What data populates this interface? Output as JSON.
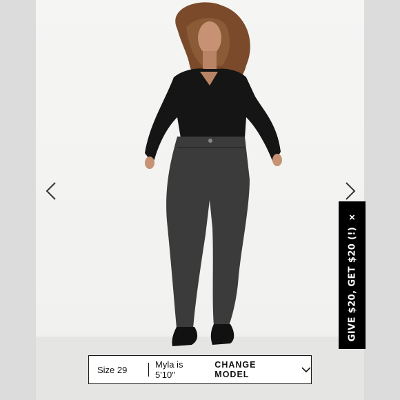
{
  "promo": {
    "text": "GIVE $20, GET $20 (!)",
    "close": "×"
  },
  "size_bar": {
    "size": "Size 29",
    "model_height": "Myla is 5'10\"",
    "change_label": "CHANGE MODEL"
  },
  "icons": {
    "prev": "chevron-left-icon",
    "next": "chevron-right-icon",
    "dropdown": "chevron-down-icon"
  },
  "colors": {
    "promo_bg": "#000000",
    "jeans": "#3b3b3b",
    "top": "#151515"
  }
}
